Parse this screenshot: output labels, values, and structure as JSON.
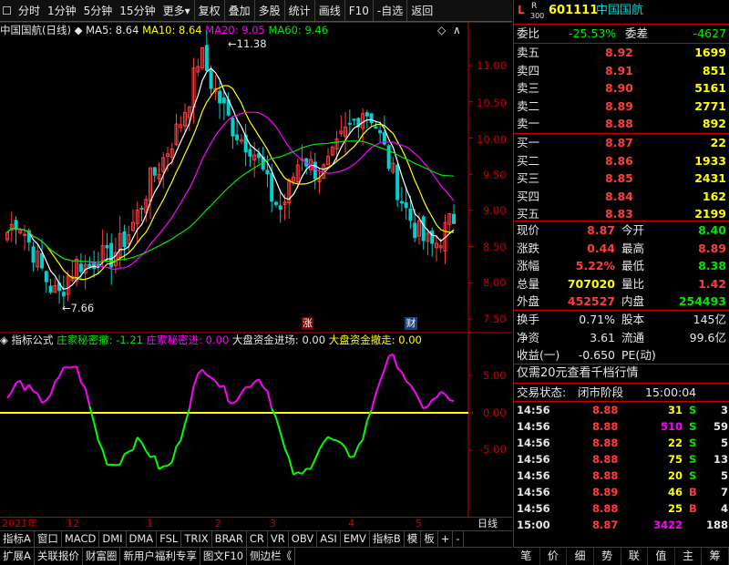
{
  "toolbar": {
    "items": [
      "分时",
      "1分钟",
      "5分钟",
      "15分钟",
      "更多",
      "复权",
      "叠加",
      "多股",
      "统计",
      "画线",
      "F10",
      "-自选",
      "返回"
    ]
  },
  "kline": {
    "name": "中国国航(日线)",
    "ma5_label": "MA5: 8.64",
    "ma10_label": "MA10: 8.64",
    "ma20_label": "MA20: 9.05",
    "ma60_label": "MA60: 9.46",
    "high_mark": "11.38",
    "low_mark": "7.66",
    "y_ticks": [
      "11.00",
      "10.50",
      "10.00",
      "9.50",
      "9.00",
      "8.50",
      "8.00",
      "7.50"
    ],
    "badge_up": "涨",
    "badge_fin": "财"
  },
  "indicator": {
    "name": "指标公式",
    "l1": "庄家秘密撤: -1.21",
    "l2": "庄家秘密进: 0.00",
    "l3": "大盘资金进场: 0.00",
    "l4": "大盘资金撤走: 0.00",
    "y_ticks": [
      "5.00",
      "0.00",
      "-5.00"
    ]
  },
  "xaxis": {
    "labels": [
      "2021年",
      "12",
      "1",
      "2",
      "3",
      "4",
      "5"
    ],
    "right": "日线"
  },
  "tabs1": [
    "指标A",
    "窗口",
    "MACD",
    "DMI",
    "DMA",
    "FSL",
    "TRIX",
    "BRAR",
    "CR",
    "VR",
    "OBV",
    "ASI",
    "EMV",
    "指标B",
    "模",
    "板",
    "+",
    "-"
  ],
  "tabs2": [
    "扩展A",
    "关联报价",
    "财富圈",
    "新用户福利专享",
    "图文F10",
    "侧边栏《"
  ],
  "quote": {
    "code": "601111",
    "name": "中国国航",
    "tag_l": "L",
    "tag_r": "R",
    "tag_300": "300",
    "webi_label": "委比",
    "webi": "-25.53%",
    "weicha_label": "委差",
    "weicha": "-4627",
    "sell": [
      {
        "l": "卖五",
        "p": "8.92",
        "v": "1699"
      },
      {
        "l": "卖四",
        "p": "8.91",
        "v": "851"
      },
      {
        "l": "卖三",
        "p": "8.90",
        "v": "5161"
      },
      {
        "l": "卖二",
        "p": "8.89",
        "v": "2771"
      },
      {
        "l": "卖一",
        "p": "8.88",
        "v": "892"
      }
    ],
    "buy": [
      {
        "l": "买一",
        "p": "8.87",
        "v": "22"
      },
      {
        "l": "买二",
        "p": "8.86",
        "v": "1933"
      },
      {
        "l": "买三",
        "p": "8.85",
        "v": "2431"
      },
      {
        "l": "买四",
        "p": "8.84",
        "v": "162"
      },
      {
        "l": "买五",
        "p": "8.83",
        "v": "2199"
      }
    ],
    "stats": [
      {
        "a": "现价",
        "av": "8.87",
        "ac": "red",
        "b": "今开",
        "bv": "8.40",
        "bc": "green"
      },
      {
        "a": "涨跌",
        "av": "0.44",
        "ac": "red",
        "b": "最高",
        "bv": "8.89",
        "bc": "red"
      },
      {
        "a": "涨幅",
        "av": "5.22%",
        "ac": "red",
        "b": "最低",
        "bv": "8.38",
        "bc": "green"
      },
      {
        "a": "总量",
        "av": "707020",
        "ac": "yellow",
        "b": "量比",
        "bv": "1.42",
        "bc": "red"
      },
      {
        "a": "外盘",
        "av": "452527",
        "ac": "red",
        "b": "内盘",
        "bv": "254493",
        "bc": "green"
      }
    ],
    "stats2": [
      {
        "a": "换手",
        "av": "0.71%",
        "b": "股本",
        "bv": "145亿"
      },
      {
        "a": "净资",
        "av": "3.61",
        "b": "流通",
        "bv": "99.6亿"
      },
      {
        "a": "收益(一)",
        "av": "-0.650",
        "b": "PE(动)",
        "bv": ""
      }
    ],
    "promo": "仅需20元查看千档行情",
    "status_label": "交易状态:",
    "status": "闭市阶段",
    "status_time": "15:00:04",
    "ticks": [
      {
        "t": "14:56",
        "p": "8.88",
        "v": "31",
        "s": "S",
        "n": "3",
        "vc": "yellow",
        "sc": "green"
      },
      {
        "t": "14:56",
        "p": "8.88",
        "v": "510",
        "s": "S",
        "n": "59",
        "vc": "mag",
        "sc": "green"
      },
      {
        "t": "14:56",
        "p": "8.88",
        "v": "22",
        "s": "S",
        "n": "5",
        "vc": "yellow",
        "sc": "green"
      },
      {
        "t": "14:56",
        "p": "8.88",
        "v": "75",
        "s": "S",
        "n": "13",
        "vc": "yellow",
        "sc": "green"
      },
      {
        "t": "14:56",
        "p": "8.88",
        "v": "20",
        "s": "S",
        "n": "5",
        "vc": "yellow",
        "sc": "green"
      },
      {
        "t": "14:56",
        "p": "8.89",
        "v": "46",
        "s": "B",
        "n": "7",
        "vc": "yellow",
        "sc": "red"
      },
      {
        "t": "14:56",
        "p": "8.88",
        "v": "25",
        "s": "B",
        "n": "4",
        "vc": "yellow",
        "sc": "red"
      },
      {
        "t": "15:00",
        "p": "8.87",
        "v": "3422",
        "s": "",
        "n": "188",
        "vc": "mag",
        "sc": "red"
      }
    ]
  },
  "bottomtabs": [
    "笔",
    "价",
    "细",
    "势",
    "联",
    "值",
    "主",
    "筹"
  ],
  "colors": {
    "up": "#ff3c3c",
    "down": "#00d0d0",
    "grid": "#c80000",
    "ma5": "#ffffff",
    "ma10": "#ffff00",
    "ma20": "#ff00ff",
    "ma60": "#00e600"
  }
}
